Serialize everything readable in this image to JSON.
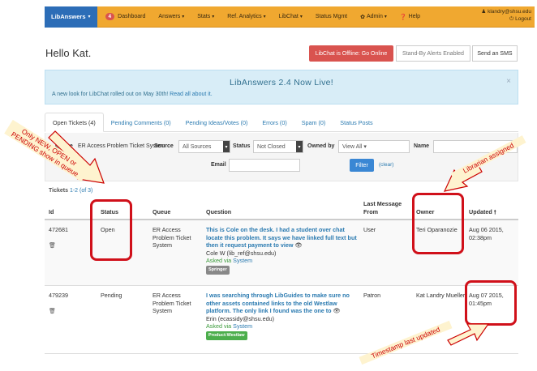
{
  "nav": {
    "brand": "LibAnswers",
    "dashboard_badge": "4",
    "dashboard": "Dashboard",
    "answers": "Answers",
    "stats": "Stats",
    "ref_analytics": "Ref. Analytics",
    "libchat": "LibChat",
    "status_mgmt": "Status Mgmt",
    "admin": "Admin",
    "help": "Help",
    "user": "klandry@shsu.edu",
    "logout": "Logout"
  },
  "greeting": "Hello Kat.",
  "buttons": {
    "libchat_offline": "LibChat is Offline: Go Online",
    "standby": "Stand-By Alerts Enabled",
    "sms": "Send an SMS"
  },
  "alert": {
    "title": "LibAnswers 2.4 Now Live!",
    "text": "A new look for LibChat rolled out on May 30th!",
    "link": "Read all about it.",
    "close": "×"
  },
  "tabs": [
    {
      "label": "Open Tickets (4)"
    },
    {
      "label": "Pending Comments (0)"
    },
    {
      "label": "Pending Ideas/Votes (0)"
    },
    {
      "label": "Errors (0)"
    },
    {
      "label": "Spam (0)"
    },
    {
      "label": "Status Posts"
    }
  ],
  "filter": {
    "queue_label": "Queue",
    "queue_value": "ER Access Problem Ticket System",
    "source_label": "Source",
    "source_value": "All Sources",
    "status_label": "Status",
    "status_value": "Not Closed",
    "owned_label": "Owned by",
    "owned_value": "View All",
    "name_label": "Name",
    "email_label": "Email",
    "filter_button": "Filter",
    "clear": "(clear)"
  },
  "tickets_heading": "Tickets",
  "tickets_range": "1-2 (of 3)",
  "columns": {
    "id": "Id",
    "status": "Status",
    "queue": "Queue",
    "question": "Question",
    "last_message": "Last Message From",
    "owner": "Owner",
    "updated": "Updated"
  },
  "rows": [
    {
      "id": "472681",
      "status": "Open",
      "queue": "ER Access Problem Ticket System",
      "question": "This is Cole on the desk. I had a student over chat locate this problem. It says we have linked full text but then it request payment to view",
      "asker": "Cole W (lib_ref@shsu.edu)",
      "asked_via_prefix": "Asked via",
      "asked_via": "System",
      "tag": "Springer",
      "last_message": "User",
      "owner": "Teri Oparanozie",
      "updated": "Aug 06 2015, 02:38pm"
    },
    {
      "id": "479239",
      "status": "Pending",
      "queue": "ER Access Problem Ticket System",
      "question": "I was searching through LibGuides to make sure no other assets contained links to the old Westlaw platform. The only link I found was the one to",
      "asker": "Erin (ecassidy@shsu.edu)",
      "asked_via_prefix": "Asked via",
      "asked_via": "System",
      "tag": "Product:Westlaw",
      "last_message": "Patron",
      "owner": "Kat Landry Mueller",
      "updated": "Aug 07 2015, 01:45pm"
    }
  ],
  "annotations": {
    "queue_note": "Only NEW, OPEN or PENDING show in queue",
    "librarian_note": "Librarian assigned",
    "timestamp_note": "Timestamp last updated"
  },
  "colors": {
    "navbar": "#f0a830",
    "brand": "#2c6db7",
    "annotation_red": "#d0101a",
    "annotation_bg": "#fef3cf"
  }
}
